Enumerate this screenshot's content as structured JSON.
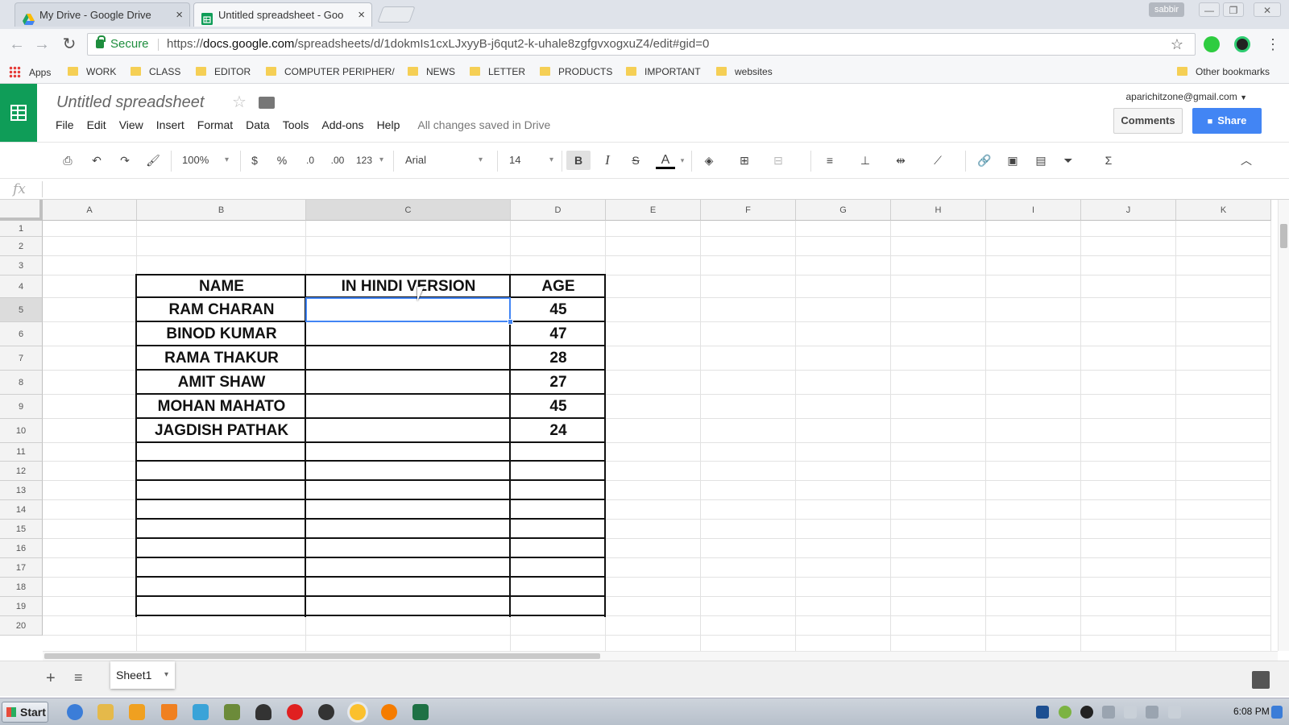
{
  "browser": {
    "tabs": [
      {
        "title": "My Drive - Google Drive",
        "close": "×"
      },
      {
        "title": "Untitled spreadsheet - Goo",
        "close": "×"
      }
    ],
    "profile": "sabbir",
    "window_controls": [
      "—",
      "❐",
      "✕"
    ],
    "security_label": "Secure",
    "url_prefix": "https://",
    "url_host": "docs.google.com",
    "url_path": "/spreadsheets/d/1dokmIs1cxLJxyyB-j6qut2-k-uhale8zgfgvxogxuZ4/edit#gid=0",
    "bookmarks": [
      {
        "label": "Apps",
        "icon": "apps-grid-icon"
      },
      {
        "label": "WORK",
        "icon": "folder-icon"
      },
      {
        "label": "CLASS",
        "icon": "folder-icon"
      },
      {
        "label": "EDITOR",
        "icon": "folder-icon"
      },
      {
        "label": "COMPUTER PERIPHER/",
        "icon": "folder-icon"
      },
      {
        "label": "NEWS",
        "icon": "folder-icon"
      },
      {
        "label": "LETTER",
        "icon": "folder-icon"
      },
      {
        "label": "PRODUCTS",
        "icon": "folder-icon"
      },
      {
        "label": "IMPORTANT",
        "icon": "folder-icon"
      },
      {
        "label": "websites",
        "icon": "folder-icon"
      }
    ],
    "other_bookmarks": "Other bookmarks"
  },
  "sheets": {
    "title": "Untitled spreadsheet",
    "account": "aparichitzone@gmail.com",
    "menu": [
      "File",
      "Edit",
      "View",
      "Insert",
      "Format",
      "Data",
      "Tools",
      "Add-ons",
      "Help"
    ],
    "save_status": "All changes saved in Drive",
    "comments_label": "Comments",
    "share_label": "Share",
    "toolbar": {
      "zoom": "100%",
      "currency": "$",
      "percent": "%",
      "dec_less": ".0",
      "dec_more": ".00",
      "more_formats": "123",
      "font": "Arial",
      "font_size": "14",
      "bold": "B",
      "italic": "I",
      "strike": "S",
      "text_color": "A"
    },
    "formula_label": "fx",
    "columns": [
      "A",
      "B",
      "C",
      "D",
      "E",
      "F",
      "G",
      "H",
      "I",
      "J",
      "K"
    ],
    "rows": [
      "1",
      "2",
      "3",
      "4",
      "5",
      "6",
      "7",
      "8",
      "9",
      "10",
      "11",
      "12",
      "13",
      "14",
      "15",
      "16",
      "17",
      "18",
      "19",
      "20"
    ],
    "selected_column": "C",
    "selected_row": "5",
    "table": {
      "headers": [
        "NAME",
        "IN HINDI VERSION",
        "AGE"
      ],
      "rows": [
        [
          "RAM CHARAN",
          "",
          "45"
        ],
        [
          "BINOD KUMAR",
          "",
          "47"
        ],
        [
          "RAMA THAKUR",
          "",
          "28"
        ],
        [
          "AMIT SHAW",
          "",
          "27"
        ],
        [
          "MOHAN MAHATO",
          "",
          "45"
        ],
        [
          "JAGDISH PATHAK",
          "",
          "24"
        ]
      ]
    },
    "sheet_tab": "Sheet1",
    "sheet_add": "+",
    "sheet_list": "≡"
  },
  "taskbar": {
    "start_label": "Start",
    "clock": "6:08 PM"
  },
  "colors": {
    "sheets_green": "#0f9d58",
    "share_blue": "#4285f4",
    "selection_blue": "#4285f4"
  }
}
